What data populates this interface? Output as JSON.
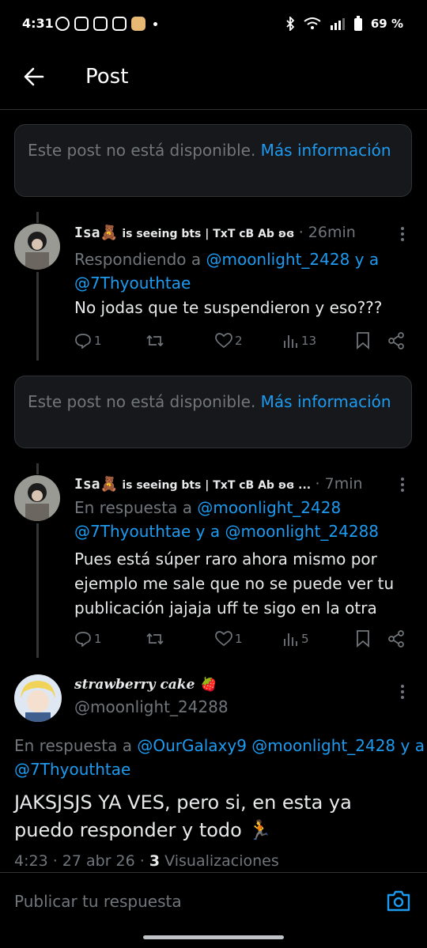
{
  "status_bar": {
    "time": "4:31",
    "battery": "69 %"
  },
  "header": {
    "title": "Post"
  },
  "unavailable": {
    "text": "Este post no está disponible.",
    "link": "Más información"
  },
  "replies": [
    {
      "name": "Isa🧸",
      "badge": "is seeing bts | TxT cB Ab ʚɞ",
      "time": "· 26min",
      "context_prefix": "Respondiendo a",
      "context_mentions": "@moonlight_2428 y a @7Thyouthtae",
      "text": "No jodas que te suspendieron y eso???",
      "replies": "1",
      "retweets": "",
      "likes": "2",
      "views": "13"
    },
    {
      "name": "Isa🧸",
      "badge": "is seeing bts | TxT cB Ab ʚɞ ...",
      "time": "· 7min",
      "context_prefix": "En respuesta a",
      "context_mentions": "@moonlight_2428 @7Thyouthtae y a @moonlight_24288",
      "text": "Pues está súper raro ahora mismo por ejemplo me sale que no se puede ver tu publicación jajaja uff te sigo en la otra",
      "replies": "1",
      "retweets": "",
      "likes": "1",
      "views": "5"
    }
  ],
  "main_post": {
    "name": "strawberry cake 🍓",
    "handle": "@moonlight_24288",
    "context_prefix": "En respuesta a",
    "context_mentions": "@OurGalaxy9 @moonlight_2428 y a @7Thyouthtae",
    "text": "JAKSJSJS YA VES, pero si, en esta ya puedo responder y todo 🏃",
    "meta_time": "4:23 · 27 abr 26 · ",
    "views_count": "3",
    "views_label": "Visualizaciones"
  },
  "composer": {
    "placeholder": "Publicar tu respuesta"
  },
  "colors": {
    "accent": "#1d9bf0",
    "background": "#000000",
    "muted": "#71767b"
  }
}
